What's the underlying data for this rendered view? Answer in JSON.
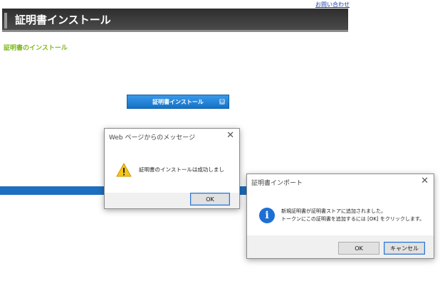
{
  "top_link": "お問い合わせ",
  "header": {
    "title": "証明書インストール"
  },
  "section_title": "証明書のインストール",
  "install_button": {
    "label": "証明書インストール"
  },
  "message_dialog": {
    "title": "Web ページからのメッセージ",
    "icon": "warning-icon",
    "message": "証明書のインストールは成功しまし",
    "ok_label": "OK"
  },
  "import_dialog": {
    "title": "証明書インポート",
    "icon": "info-icon",
    "message_line1": "新規証明書が証明書ストアに追加されました。",
    "message_line2": "トークンにこの証明書を追加するには [OK] をクリックします。",
    "ok_label": "OK",
    "cancel_label": "キャンセル"
  },
  "colors": {
    "header_bg": "#3a3a3a",
    "section_title": "#7eb61c",
    "install_button": "#1e82dc",
    "band": "#1d6fc0"
  }
}
